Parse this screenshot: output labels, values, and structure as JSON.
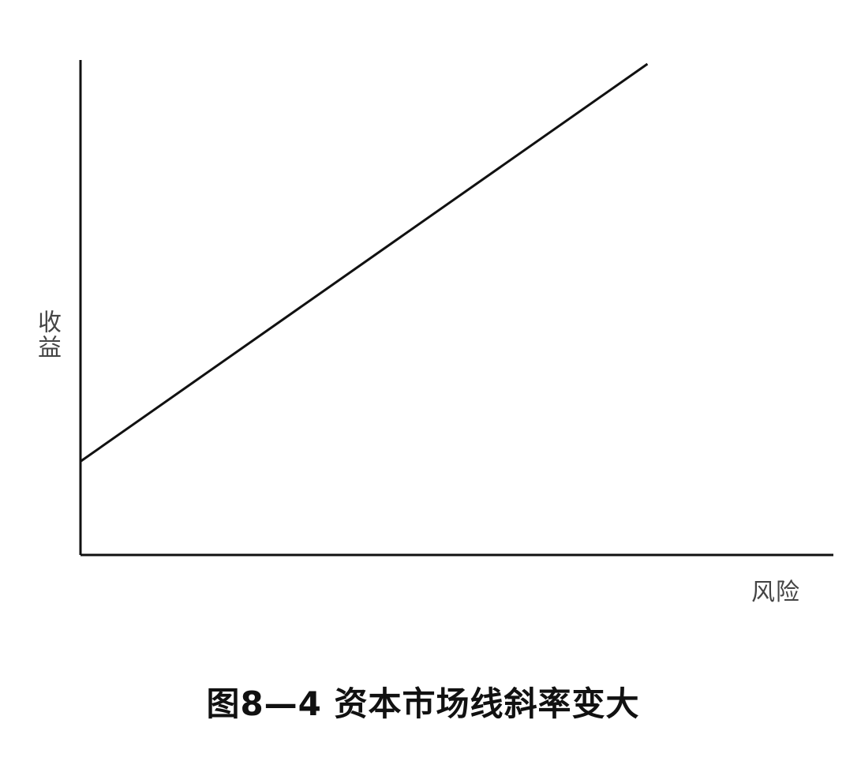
{
  "chart_data": {
    "type": "line",
    "title": "图8—4 资本市场线斜率变大",
    "xlabel": "风险",
    "ylabel": "收益",
    "xlim": [
      0,
      100
    ],
    "ylim": [
      0,
      100
    ],
    "grid": false,
    "legend": "none",
    "x_ticks_shown": false,
    "y_ticks_shown": false,
    "line_color": "#111111",
    "axis_color": "#111111",
    "series": [
      {
        "x": [
          0,
          75.3
        ],
        "y": [
          18.9,
          99.2
        ]
      }
    ]
  }
}
